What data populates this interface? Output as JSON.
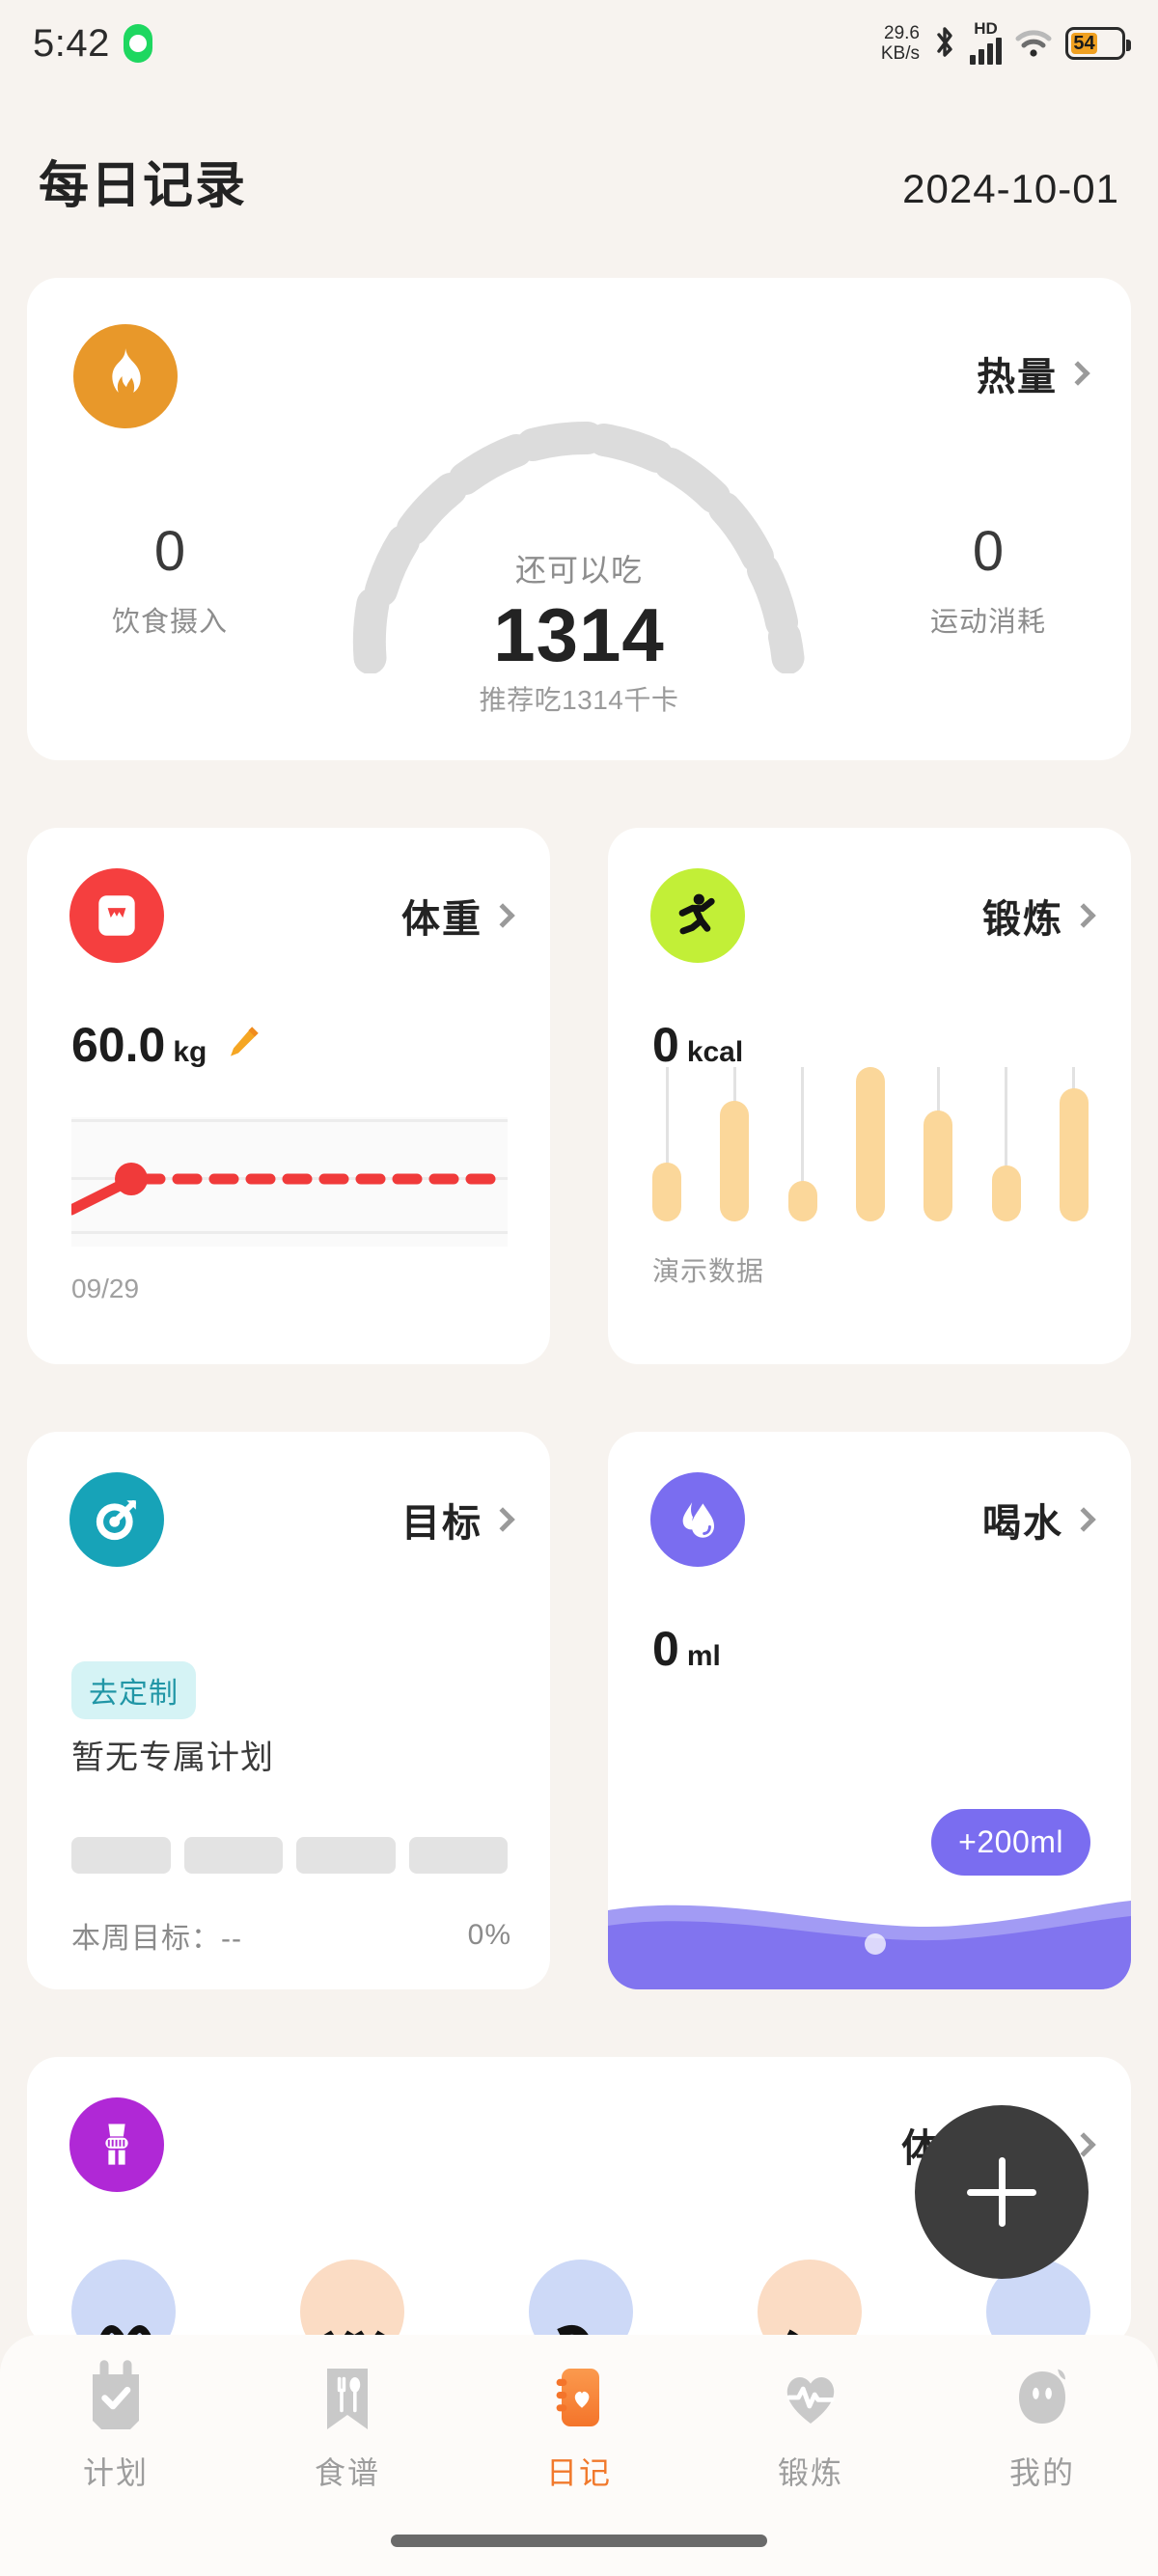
{
  "statusbar": {
    "time": "5:42",
    "recording_indicator": "recording-dot",
    "net_speed_value": "29.6",
    "net_speed_unit": "KB/s",
    "bluetooth": "bluetooth-icon",
    "hd": "HD",
    "signal": "signal-bars-icon",
    "wifi": "wifi-icon",
    "battery_level": "54"
  },
  "header": {
    "title": "每日记录",
    "date": "2024-10-01"
  },
  "calorie": {
    "icon": "flame-icon",
    "title": "热量",
    "gauge_label": "还可以吃",
    "gauge_value": "1314",
    "gauge_sub": "推荐吃1314千卡",
    "left_value": "0",
    "left_label": "饮食摄入",
    "right_value": "0",
    "right_label": "运动消耗"
  },
  "weight": {
    "icon": "weight-scale-icon",
    "title": "体重",
    "value": "60.0",
    "unit": "kg",
    "edit_icon": "pencil-icon",
    "date": "09/29"
  },
  "exercise": {
    "icon": "running-person-icon",
    "title": "锻炼",
    "value": "0",
    "unit": "kcal",
    "note": "演示数据",
    "bars": [
      38,
      78,
      26,
      100,
      72,
      36,
      86
    ]
  },
  "goal": {
    "icon": "target-icon",
    "title": "目标",
    "badge": "去定制",
    "empty_text": "暂无专属计划",
    "footer_label": "本周目标：--",
    "footer_percent": "0%"
  },
  "water": {
    "icon": "water-drop-icon",
    "title": "喝水",
    "value": "0",
    "unit": "ml",
    "add_button": "+200ml",
    "accent": "#7a6df0"
  },
  "body": {
    "icon": "measuring-tape-icon",
    "title": "体围记录",
    "avatars": [
      "avatar-chest",
      "avatar-waist",
      "avatar-hip",
      "avatar-arm",
      "avatar-thigh"
    ]
  },
  "fab": {
    "icon": "plus-icon"
  },
  "bottomnav": {
    "items": [
      {
        "label": "计划",
        "icon": "clipboard-check-icon",
        "active": false
      },
      {
        "label": "食谱",
        "icon": "fork-spoon-icon",
        "active": false
      },
      {
        "label": "日记",
        "icon": "diary-heart-icon",
        "active": true
      },
      {
        "label": "锻炼",
        "icon": "heart-pulse-icon",
        "active": false
      },
      {
        "label": "我的",
        "icon": "person-icon",
        "active": false
      }
    ],
    "active_color": "#f1792c"
  }
}
